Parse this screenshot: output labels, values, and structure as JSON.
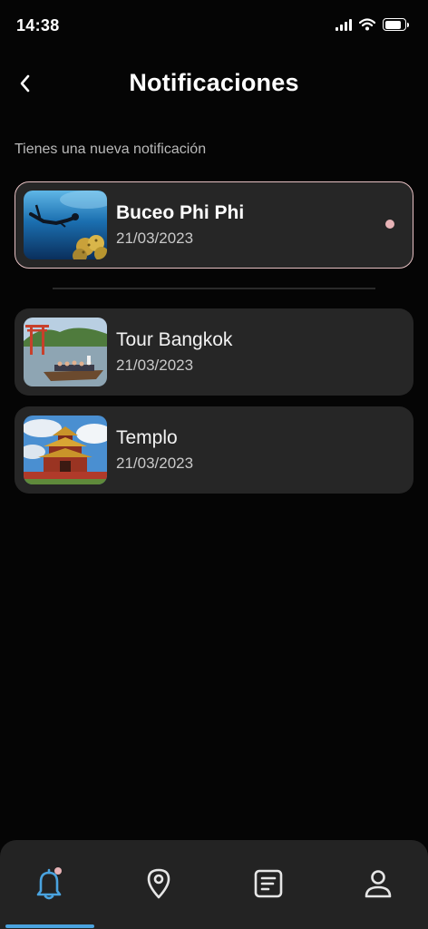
{
  "status_bar": {
    "time": "14:38",
    "battery_level": 0.85,
    "icons": [
      "signal-icon",
      "wifi-icon",
      "battery-icon"
    ]
  },
  "header": {
    "title": "Notificaciones",
    "back_icon": "chevron-left-icon"
  },
  "subtitle": "Tienes una nueva notificación",
  "notifications": [
    {
      "title": "Buceo Phi Phi",
      "date": "21/03/2023",
      "unread": true,
      "image": "diver-underwater-image"
    },
    {
      "title": "Tour Bangkok",
      "date": "21/03/2023",
      "unread": false,
      "image": "boat-tour-image"
    },
    {
      "title": "Templo",
      "date": "21/03/2023",
      "unread": false,
      "image": "temple-image"
    }
  ],
  "bottom_nav": {
    "items": [
      {
        "name": "notifications",
        "icon": "bell-icon",
        "active": true,
        "badge": true
      },
      {
        "name": "map",
        "icon": "map-pin-icon",
        "active": false
      },
      {
        "name": "documents",
        "icon": "document-icon",
        "active": false
      },
      {
        "name": "profile",
        "icon": "user-icon",
        "active": false
      }
    ]
  },
  "colors": {
    "background": "#050505",
    "card": "#262626",
    "unread_border": "#e7c1c3",
    "unread_dot": "#e7b3b6",
    "active_nav": "#4aa3df",
    "nav_background": "#232323"
  }
}
